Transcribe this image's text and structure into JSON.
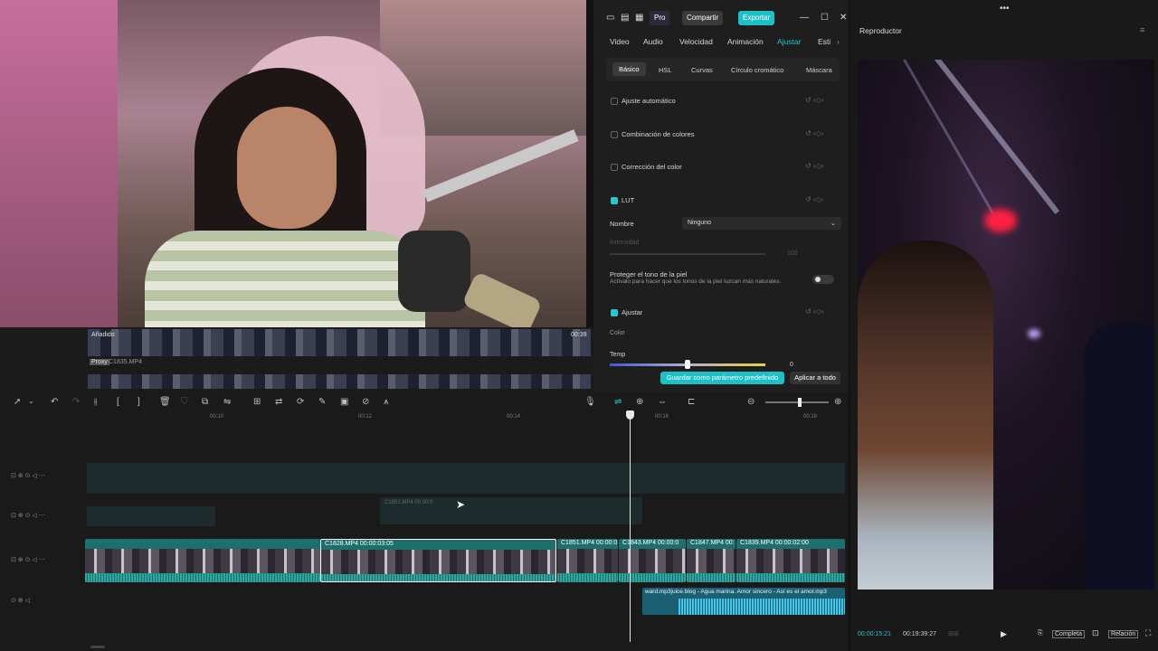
{
  "webcam": {
    "description_free": true
  },
  "media": {
    "row1_label": "Añadido",
    "row1_duration": "00:39",
    "proxy_badge": "Proxy",
    "proxy_file": "C1835.MP4"
  },
  "header": {
    "pro": "Pro",
    "share": "Compartir",
    "export": "Exportar"
  },
  "tabs": [
    "Video",
    "Audio",
    "Velocidad",
    "Animación",
    "Ajustar",
    "Esti"
  ],
  "active_tab": "Ajustar",
  "subtabs": [
    "Básico",
    "HSL",
    "Curvas",
    "Círculo cromático",
    "Máscara"
  ],
  "adjust": {
    "auto": "Ajuste automático",
    "combo": "Combinación de colores",
    "correction": "Corrección del color",
    "lut": "LUT",
    "name_label": "Nombre",
    "name_value": "Ninguno",
    "intensity_label": "Intensidad",
    "intensity_value": "100",
    "skin_title": "Proteger el tono de la piel",
    "skin_desc": "Actívalo para hacer que los tonos de la piel luzcan más naturales.",
    "adjust_section": "Ajustar",
    "color_label": "Color",
    "temp_label": "Temp",
    "temp_value": "0",
    "save_preset": "Guardar como parámetro predefinido",
    "apply_all": "Aplicar a todo"
  },
  "player": {
    "title": "Reproductor",
    "current_time": "00:00:15:21",
    "total_time": "00:19:39:27",
    "full": "Completa",
    "ratio": "Relación"
  },
  "timeline": {
    "ruler": [
      "00:10",
      "00:12",
      "00:14",
      "00:16",
      "00:18"
    ],
    "ghost_label": "C1851.MP4   00:00:0",
    "clips": [
      {
        "name": "C1828.MP4   00:00:03:05"
      },
      {
        "name": "C1851.MP4   00:00:0"
      },
      {
        "name": "C1843.MP4   00:00:0"
      },
      {
        "name": "C1847.MP4   00:"
      },
      {
        "name": "C1839.MP4   00:00:02:00"
      }
    ],
    "audio": "ward.mp3juice.blog - Agua marina. Amor sincero - Así es el amor.mp3"
  },
  "colors": {
    "accent": "#1ec0c8",
    "clip": "#1d6f6b",
    "audio": "#1b5f72"
  }
}
